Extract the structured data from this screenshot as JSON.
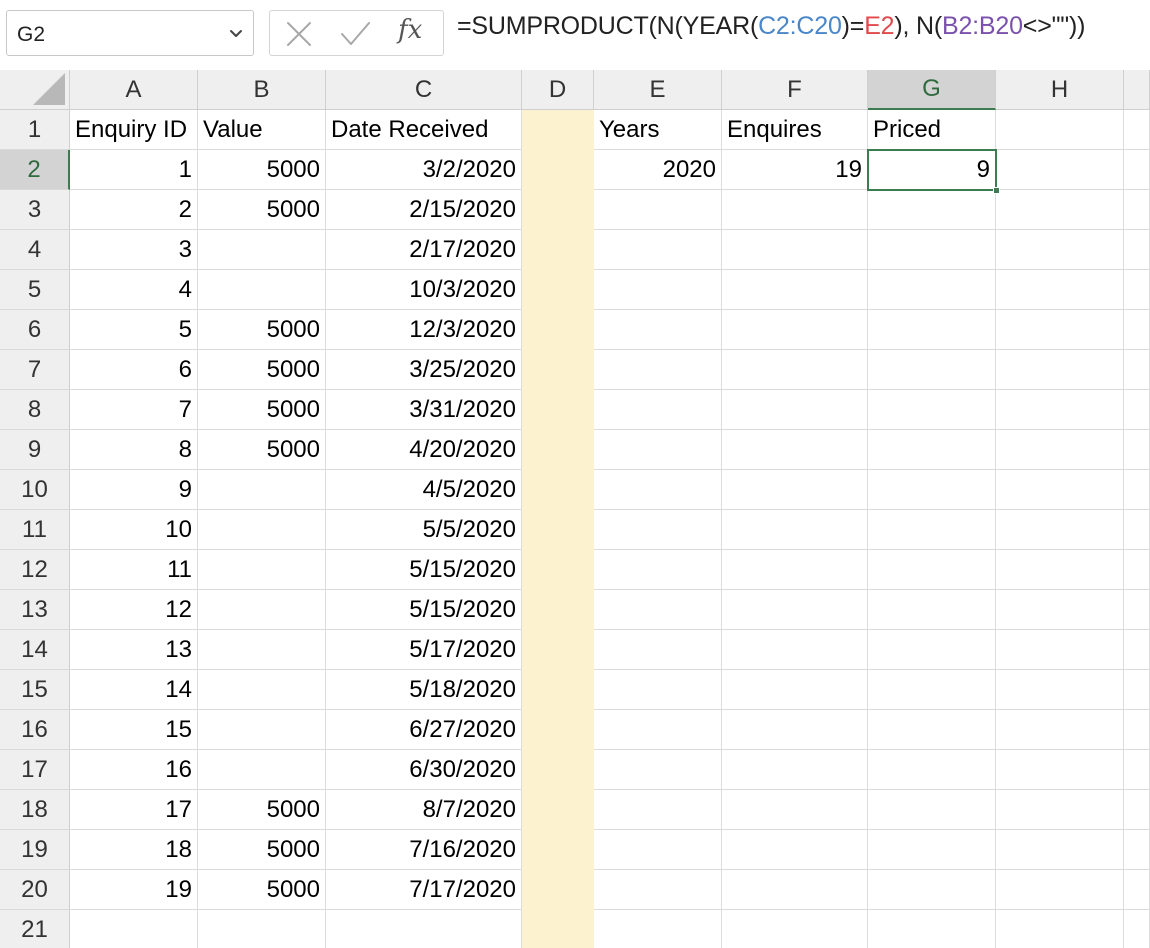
{
  "formula_bar": {
    "name_box": "G2",
    "formula_parts": [
      {
        "text": "=SUMPRODUCT(N(YEAR(",
        "color": "default"
      },
      {
        "text": "C2:C20",
        "color": "blue"
      },
      {
        "text": ")=",
        "color": "default"
      },
      {
        "text": "E2",
        "color": "red"
      },
      {
        "text": "), N(",
        "color": "default"
      },
      {
        "text": "B2:B20",
        "color": "purple"
      },
      {
        "text": "<>\"\"))",
        "color": "default"
      }
    ],
    "icons": [
      "cancel-icon",
      "enter-icon",
      "insert-function-icon"
    ],
    "fx_label": "fx"
  },
  "sheet": {
    "selected_cell": "G2",
    "selected_column": "G",
    "selected_row": "2",
    "highlight_color": "#fdf2d0",
    "accent_color": "#3e7b50",
    "columns": [
      "A",
      "B",
      "C",
      "D",
      "E",
      "F",
      "G",
      "H"
    ],
    "row_numbers": [
      "1",
      "2",
      "3",
      "4",
      "5",
      "6",
      "7",
      "8",
      "9",
      "10",
      "11",
      "12",
      "13",
      "14",
      "15",
      "16",
      "17",
      "18",
      "19",
      "20",
      "21"
    ],
    "headers": {
      "A": "Enquiry ID",
      "B": "Value",
      "C": "Date Received",
      "E": "Years",
      "F": "Enquires",
      "G": "Priced"
    },
    "rows": [
      {
        "A": "1",
        "B": "5000",
        "C": "3/2/2020"
      },
      {
        "A": "2",
        "B": "5000",
        "C": "2/15/2020"
      },
      {
        "A": "3",
        "B": "",
        "C": "2/17/2020"
      },
      {
        "A": "4",
        "B": "",
        "C": "10/3/2020"
      },
      {
        "A": "5",
        "B": "5000",
        "C": "12/3/2020"
      },
      {
        "A": "6",
        "B": "5000",
        "C": "3/25/2020"
      },
      {
        "A": "7",
        "B": "5000",
        "C": "3/31/2020"
      },
      {
        "A": "8",
        "B": "5000",
        "C": "4/20/2020"
      },
      {
        "A": "9",
        "B": "",
        "C": "4/5/2020"
      },
      {
        "A": "10",
        "B": "",
        "C": "5/5/2020"
      },
      {
        "A": "11",
        "B": "",
        "C": "5/15/2020"
      },
      {
        "A": "12",
        "B": "",
        "C": "5/15/2020"
      },
      {
        "A": "13",
        "B": "",
        "C": "5/17/2020"
      },
      {
        "A": "14",
        "B": "",
        "C": "5/18/2020"
      },
      {
        "A": "15",
        "B": "",
        "C": "6/27/2020"
      },
      {
        "A": "16",
        "B": "",
        "C": "6/30/2020"
      },
      {
        "A": "17",
        "B": "5000",
        "C": "8/7/2020"
      },
      {
        "A": "18",
        "B": "5000",
        "C": "7/16/2020"
      },
      {
        "A": "19",
        "B": "5000",
        "C": "7/17/2020"
      }
    ],
    "summary": {
      "E": "2020",
      "F": "19",
      "G": "9"
    }
  }
}
